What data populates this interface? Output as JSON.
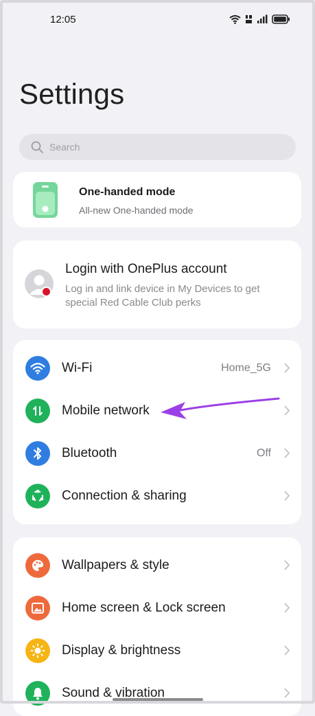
{
  "status": {
    "time": "12:05"
  },
  "page": {
    "title": "Settings"
  },
  "search": {
    "placeholder": "Search"
  },
  "one_handed": {
    "title": "One-handed mode",
    "subtitle": "All-new One-handed mode"
  },
  "account": {
    "title": "Login with OnePlus account",
    "subtitle": "Log in and link device in My Devices to get special Red Cable Club perks"
  },
  "network_group": [
    {
      "label": "Wi-Fi",
      "value": "Home_5G",
      "icon": "wifi-icon",
      "color": "#2f7de1"
    },
    {
      "label": "Mobile network",
      "value": "",
      "icon": "mobile-data-icon",
      "color": "#1fb25a"
    },
    {
      "label": "Bluetooth",
      "value": "Off",
      "icon": "bluetooth-icon",
      "color": "#2f7de1"
    },
    {
      "label": "Connection & sharing",
      "value": "",
      "icon": "connection-sharing-icon",
      "color": "#1fb25a"
    }
  ],
  "display_group": [
    {
      "label": "Wallpapers & style",
      "icon": "palette-icon",
      "color": "#ee6a3c"
    },
    {
      "label": "Home screen & Lock screen",
      "icon": "image-icon",
      "color": "#ee6a3c"
    },
    {
      "label": "Display & brightness",
      "icon": "brightness-icon",
      "color": "#f6b514"
    },
    {
      "label": "Sound & vibration",
      "icon": "bell-icon",
      "color": "#1fb25a"
    }
  ],
  "colors": {
    "background": "#f2f1f6",
    "card": "#ffffff",
    "annotation_arrow": "#9b3fe6"
  }
}
